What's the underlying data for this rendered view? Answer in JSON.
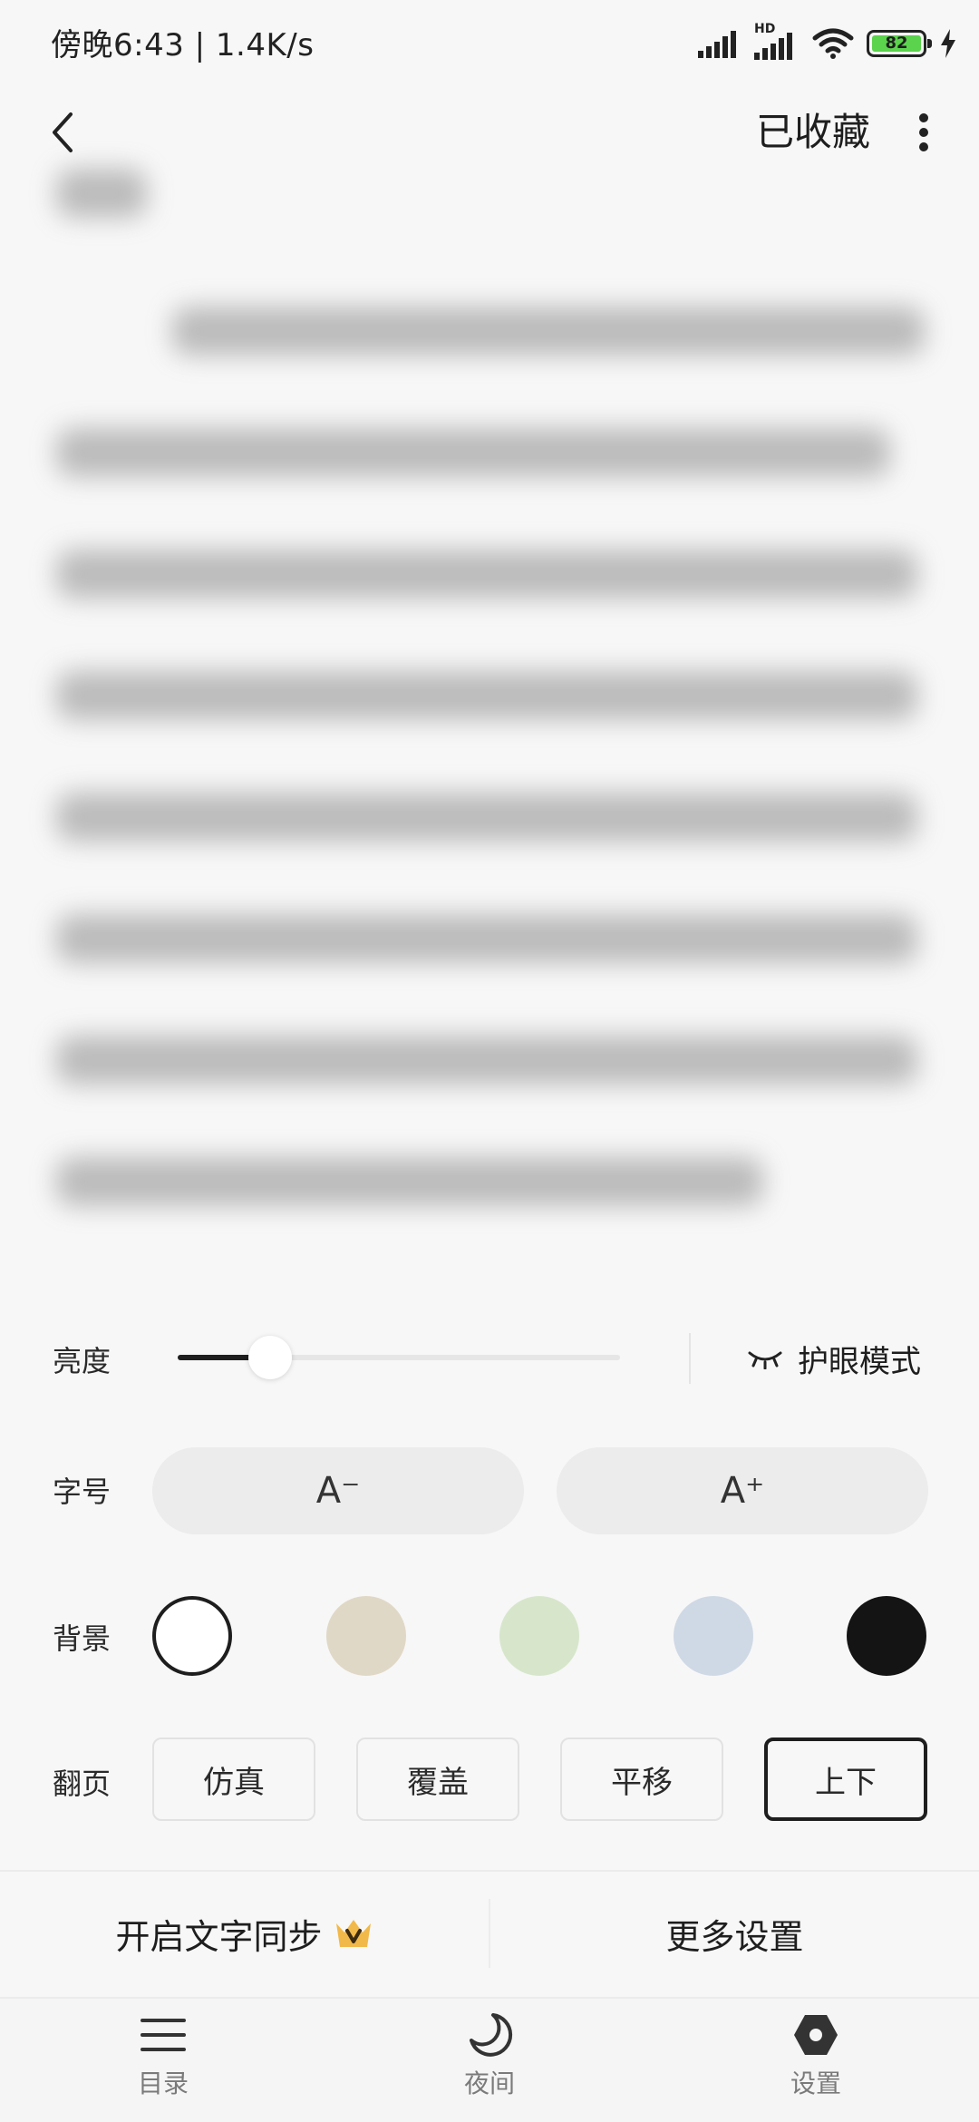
{
  "status_bar": {
    "time_speed": "傍晚6:43 | 1.4K/s",
    "network_label": "HD",
    "battery_level": "82"
  },
  "top_nav": {
    "collected_label": "已收藏"
  },
  "settings": {
    "brightness": {
      "label": "亮度",
      "value_percent": 21,
      "eye_mode_label": "护眼模式"
    },
    "font_size": {
      "label": "字号",
      "decrease_label": "A⁻",
      "increase_label": "A⁺"
    },
    "background": {
      "label": "背景",
      "options": [
        {
          "name": "white",
          "color": "#ffffff",
          "selected": true
        },
        {
          "name": "beige",
          "color": "#e0d8c6",
          "selected": false
        },
        {
          "name": "green",
          "color": "#d7e6cb",
          "selected": false
        },
        {
          "name": "blue",
          "color": "#cfd9e5",
          "selected": false
        },
        {
          "name": "black",
          "color": "#141414",
          "selected": false
        }
      ]
    },
    "page_turn": {
      "label": "翻页",
      "options": [
        "仿真",
        "覆盖",
        "平移",
        "上下"
      ],
      "selected": "上下"
    }
  },
  "actions": {
    "text_sync_label": "开启文字同步",
    "more_settings_label": "更多设置"
  },
  "tabbar": {
    "items": [
      {
        "label": "目录",
        "icon": "menu-icon"
      },
      {
        "label": "夜间",
        "icon": "moon-icon"
      },
      {
        "label": "设置",
        "icon": "settings-hex-icon"
      }
    ]
  }
}
